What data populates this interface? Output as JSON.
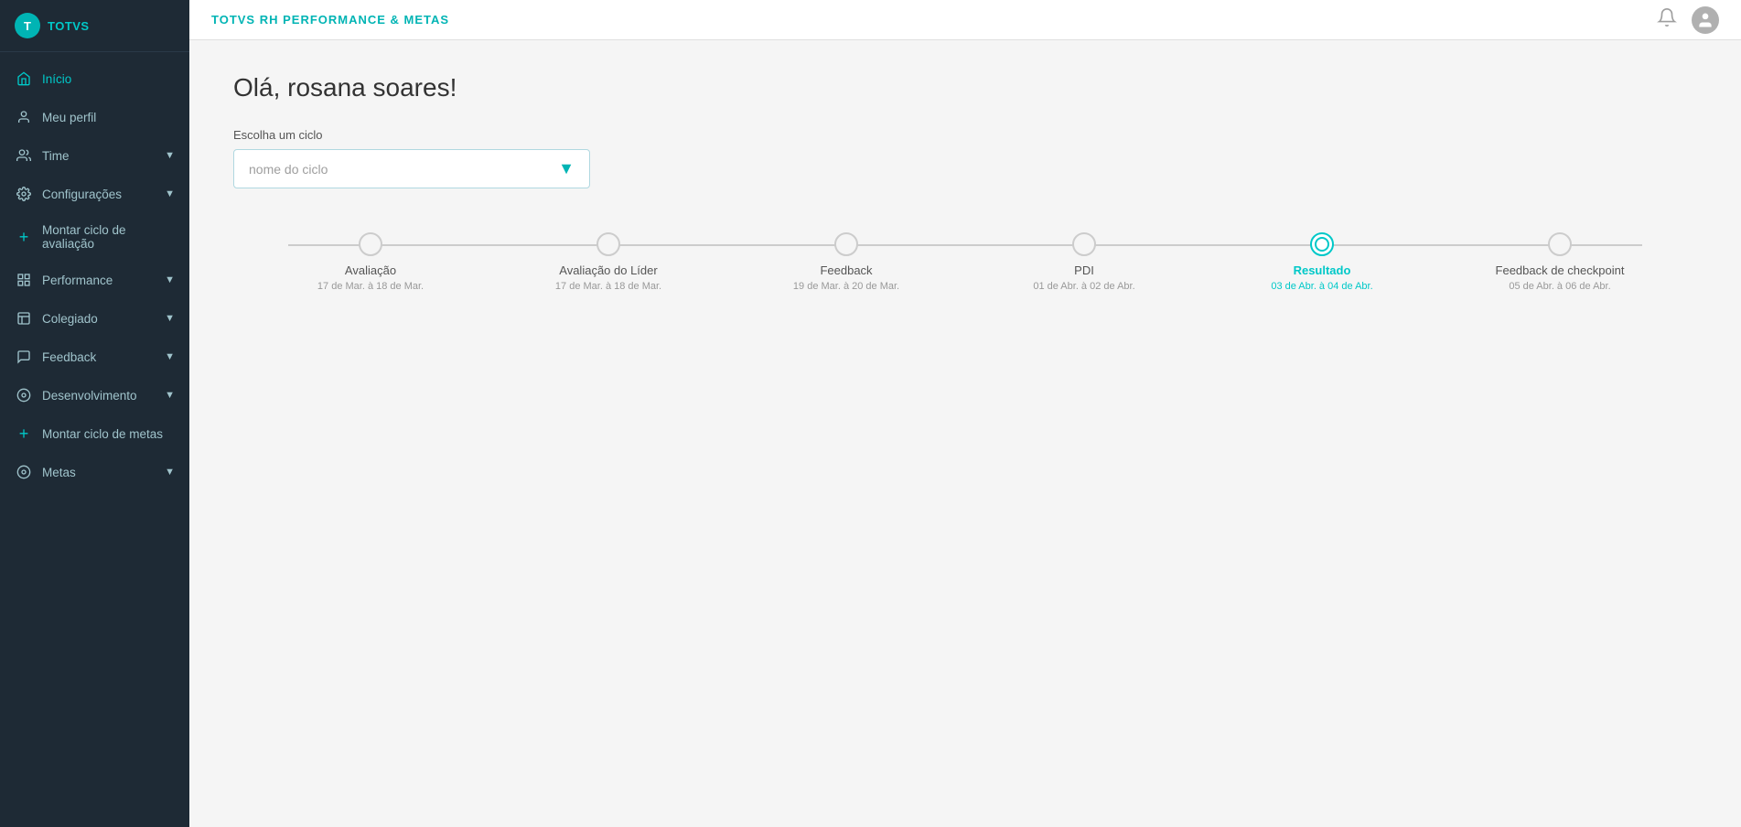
{
  "app": {
    "logo_text": "TOTVS",
    "header_title": "TOTVS RH PERFORMANCE & METAS"
  },
  "sidebar": {
    "items": [
      {
        "id": "inicio",
        "label": "Início",
        "icon": "🏠",
        "has_chevron": false,
        "active": true,
        "has_plus": false
      },
      {
        "id": "meu-perfil",
        "label": "Meu perfil",
        "icon": "👤",
        "has_chevron": false,
        "active": false,
        "has_plus": false
      },
      {
        "id": "time",
        "label": "Time",
        "icon": "👥",
        "has_chevron": true,
        "active": false,
        "has_plus": false
      },
      {
        "id": "configuracoes",
        "label": "Configurações",
        "icon": "⚙️",
        "has_chevron": true,
        "active": false,
        "has_plus": false
      },
      {
        "id": "montar-ciclo-avaliacao",
        "label": "Montar ciclo de avaliação",
        "icon": "+",
        "has_chevron": false,
        "active": false,
        "has_plus": true
      },
      {
        "id": "performance",
        "label": "Performance",
        "icon": "📊",
        "has_chevron": true,
        "active": false,
        "has_plus": false
      },
      {
        "id": "colegiado",
        "label": "Colegiado",
        "icon": "📋",
        "has_chevron": true,
        "active": false,
        "has_plus": false
      },
      {
        "id": "feedback",
        "label": "Feedback",
        "icon": "💬",
        "has_chevron": true,
        "active": false,
        "has_plus": false
      },
      {
        "id": "desenvolvimento",
        "label": "Desenvolvimento",
        "icon": "🎯",
        "has_chevron": true,
        "active": false,
        "has_plus": false
      },
      {
        "id": "montar-ciclo-metas",
        "label": "Montar ciclo de metas",
        "icon": "+",
        "has_chevron": false,
        "active": false,
        "has_plus": true
      },
      {
        "id": "metas",
        "label": "Metas",
        "icon": "🎯",
        "has_chevron": true,
        "active": false,
        "has_plus": false
      }
    ]
  },
  "topbar": {
    "title": "TOTVS RH PERFORMANCE & METAS",
    "bell_icon": "🔔",
    "avatar_icon": "👤"
  },
  "main": {
    "greeting": "Olá, rosana soares!",
    "cycle_label": "Escolha um ciclo",
    "cycle_placeholder": "nome do ciclo",
    "timeline": {
      "steps": [
        {
          "id": "avaliacao",
          "title": "Avaliação",
          "date": "17 de Mar. à 18 de Mar.",
          "active": false
        },
        {
          "id": "avaliacao-lider",
          "title": "Avaliação do Líder",
          "date": "17 de Mar. à 18 de Mar.",
          "active": false
        },
        {
          "id": "feedback",
          "title": "Feedback",
          "date": "19 de Mar. à 20 de Mar.",
          "active": false
        },
        {
          "id": "pdi",
          "title": "PDI",
          "date": "01 de Abr. à 02 de Abr.",
          "active": false
        },
        {
          "id": "resultado",
          "title": "Resultado",
          "date": "03 de Abr. à 04 de Abr.",
          "active": true
        },
        {
          "id": "feedback-checkpoint",
          "title": "Feedback de checkpoint",
          "date": "05 de Abr. à 06 de Abr.",
          "active": false
        }
      ]
    }
  }
}
